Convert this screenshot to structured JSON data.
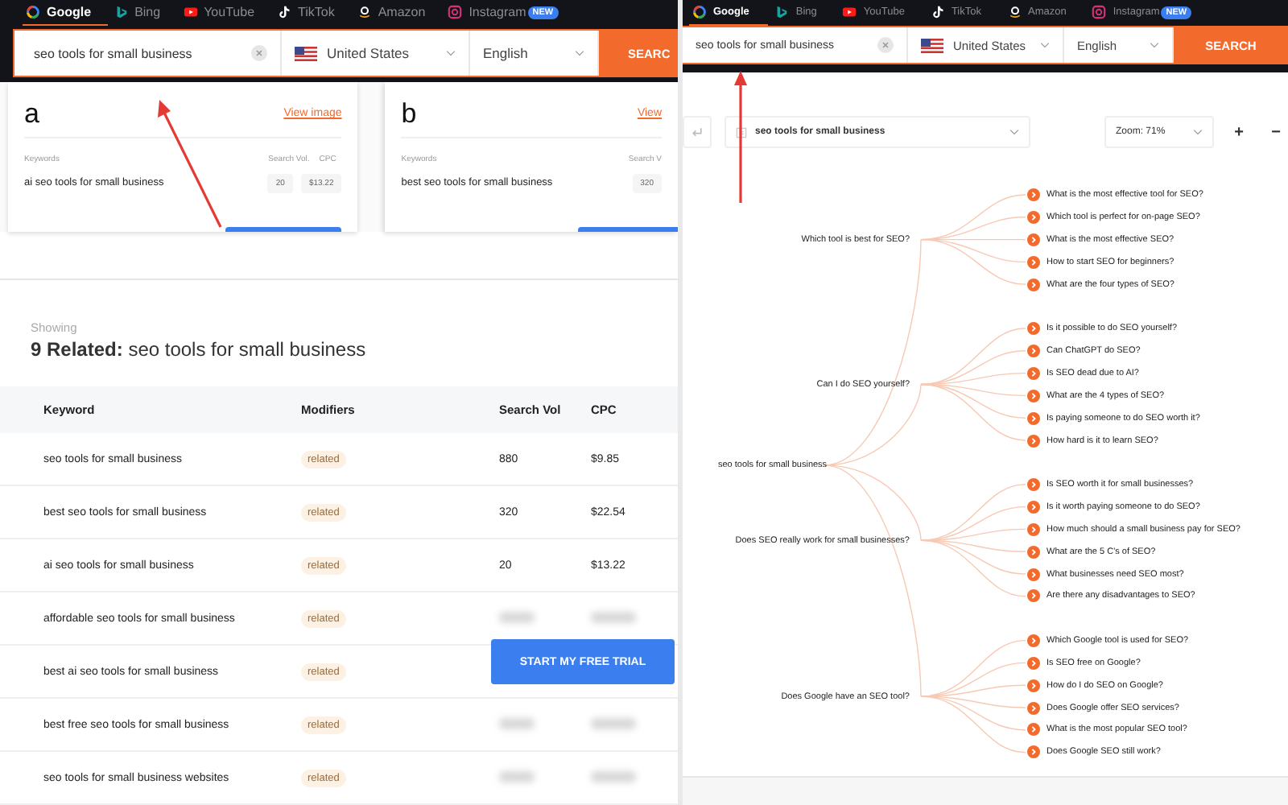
{
  "left": {
    "nav": [
      {
        "kind": "google",
        "label": "Google",
        "selected": true
      },
      {
        "kind": "bing",
        "label": "Bing",
        "selected": false
      },
      {
        "kind": "youtube",
        "label": "YouTube",
        "selected": false
      },
      {
        "kind": "tiktok",
        "label": "TikTok",
        "selected": false
      },
      {
        "kind": "amazon",
        "label": "Amazon",
        "selected": false
      },
      {
        "kind": "instagram",
        "label": "Instagram",
        "badge": "NEW",
        "selected": false
      }
    ],
    "search": {
      "value": "seo tools for small business",
      "country": "United States",
      "language": "English",
      "button": "SEARC"
    },
    "cards": [
      {
        "letter": "a",
        "link": "View image",
        "columns": [
          "Keywords",
          "Search Vol.",
          "CPC"
        ],
        "keyword": "ai seo tools for small business",
        "values": [
          "20",
          "$13.22"
        ]
      },
      {
        "letter": "b",
        "link": "View",
        "columns": [
          "Keywords",
          "Search V"
        ],
        "keyword": "best seo tools for small business",
        "values": [
          "320"
        ]
      }
    ],
    "showing": "Showing",
    "title": "**9 Related:** seo tools for small business",
    "table": {
      "columns": [
        "Keyword",
        "Modifiers",
        "Search Vol",
        "CPC"
      ],
      "rows": [
        {
          "keyword": "seo tools for small business",
          "modifier": "related",
          "blurred": false,
          "search_vol": "880",
          "cpc": "$9.85"
        },
        {
          "keyword": "best seo tools for small business",
          "modifier": "related",
          "blurred": false,
          "search_vol": "320",
          "cpc": "$22.54"
        },
        {
          "keyword": "ai seo tools for small business",
          "modifier": "related",
          "blurred": false,
          "search_vol": "20",
          "cpc": "$13.22"
        },
        {
          "keyword": "affordable seo tools for small business",
          "modifier": "related",
          "blurred": true
        },
        {
          "keyword": "best ai seo tools for small business",
          "modifier": "related"
        },
        {
          "keyword": "best free seo tools for small business",
          "modifier": "related",
          "blurred": true
        },
        {
          "keyword": "seo tools for small business websites",
          "modifier": "related",
          "blurred": true
        }
      ]
    },
    "trial_button": "START MY FREE TRIAL"
  },
  "right": {
    "nav": [
      {
        "kind": "google",
        "label": "Google",
        "selected": true
      },
      {
        "kind": "bing",
        "label": "Bing",
        "selected": false
      },
      {
        "kind": "youtube",
        "label": "YouTube",
        "selected": false
      },
      {
        "kind": "tiktok",
        "label": "TikTok",
        "selected": false
      },
      {
        "kind": "amazon",
        "label": "Amazon",
        "selected": false
      },
      {
        "kind": "instagram",
        "label": "Instagram",
        "badge": "NEW",
        "selected": false
      }
    ],
    "search": {
      "value": "seo tools for small business",
      "country": "United States",
      "language": "English",
      "button": "SEARCH"
    },
    "toolbar": {
      "topic": "seo tools for small business",
      "zoom": "Zoom: 71%",
      "zoom_in": "+",
      "zoom_out": "−"
    },
    "mind_map": {
      "root": "seo tools for small business",
      "branches": [
        {
          "label": "Which tool is best for SEO?",
          "children": [
            {
              "label": "What is the most effective tool for SEO?"
            },
            {
              "label": "Which tool is perfect for on-page SEO?"
            },
            {
              "label": "What is the most effective SEO?"
            },
            {
              "label": "How to start SEO for beginners?"
            },
            {
              "label": "What are the four types of SEO?"
            }
          ]
        },
        {
          "label": "Can I do SEO yourself?",
          "children": [
            {
              "label": "Is it possible to do SEO yourself?"
            },
            {
              "label": "Can ChatGPT do SEO?"
            },
            {
              "label": "Is SEO dead due to AI?"
            },
            {
              "label": "What are the 4 types of SEO?"
            },
            {
              "label": "Is paying someone to do SEO worth it?"
            },
            {
              "label": "How hard is it to learn SEO?"
            }
          ]
        },
        {
          "label": "Does SEO really work for small businesses?",
          "children": [
            {
              "label": "Is SEO worth it for small businesses?"
            },
            {
              "label": "Is it worth paying someone to do SEO?"
            },
            {
              "label": "How much should a small business pay for SEO?"
            },
            {
              "label": "What are the 5 C's of SEO?"
            },
            {
              "label": "What businesses need SEO most?"
            },
            {
              "label": "Are there any disadvantages to SEO?"
            }
          ]
        },
        {
          "label": "Does Google have an SEO tool?",
          "children": [
            {
              "label": "Which Google tool is used for SEO?"
            },
            {
              "label": "Is SEO free on Google?"
            },
            {
              "label": "How do I do SEO on Google?"
            },
            {
              "label": "Does Google offer SEO services?"
            },
            {
              "label": "What is the most popular SEO tool?"
            },
            {
              "label": "Does Google SEO still work?"
            }
          ]
        }
      ]
    }
  }
}
